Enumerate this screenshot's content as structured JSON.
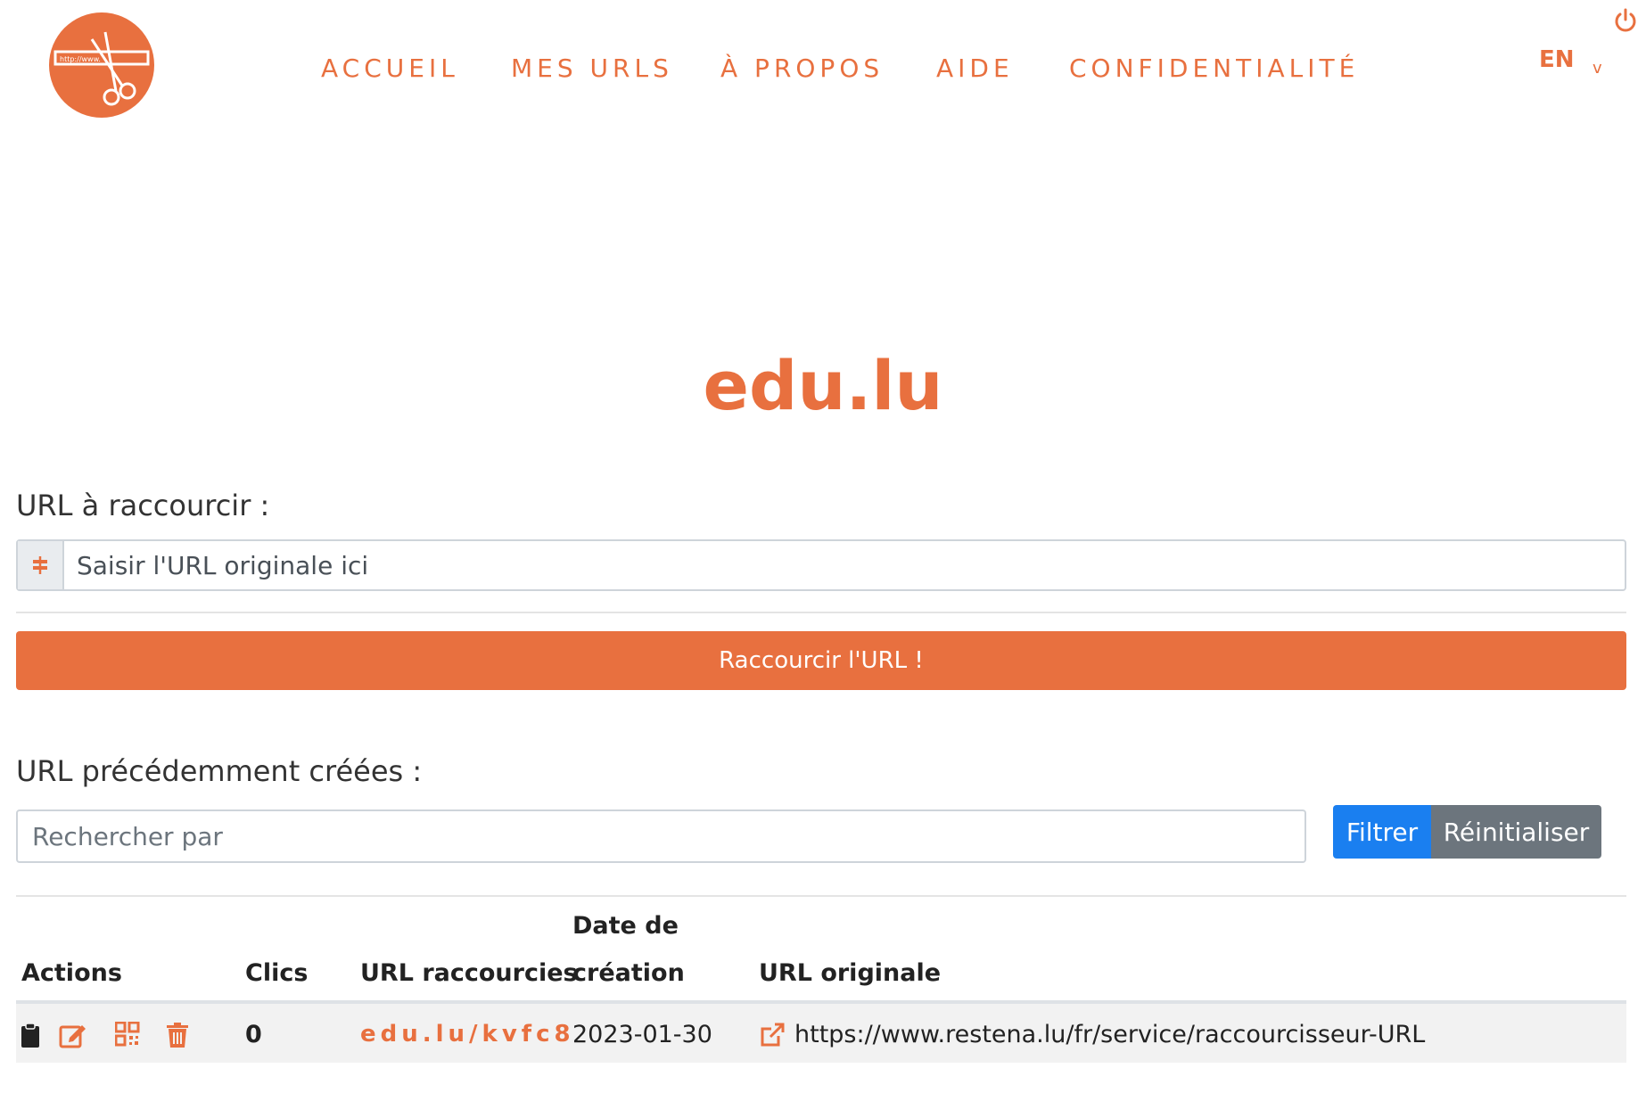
{
  "nav": {
    "items": [
      {
        "label": "ACCUEIL"
      },
      {
        "label": "MES URLS"
      },
      {
        "label": "À PROPOS"
      },
      {
        "label": "AIDE"
      },
      {
        "label": "CONFIDENTIALITÉ"
      }
    ],
    "language": "EN",
    "language_caret": "v"
  },
  "logo": {
    "text": "http://www."
  },
  "site_title": "edu.lu",
  "shorten_form": {
    "label": "URL à raccourcir :",
    "input_placeholder": "Saisir l'URL originale ici",
    "input_value": "",
    "submit_label": "Raccourcir l'URL !"
  },
  "previous": {
    "label": "URL précédemment créées :",
    "search_placeholder": "Rechercher par",
    "filter_label": "Filtrer",
    "reset_label": "Réinitialiser"
  },
  "table": {
    "headers": {
      "actions": "Actions",
      "clicks": "Clics",
      "short_url": "URL raccourcies",
      "created_line1": "Date de",
      "created_line2": "création",
      "original_url": "URL originale"
    },
    "rows": [
      {
        "actions": [
          "clipboard-icon",
          "edit-icon",
          "qr-code-icon",
          "trash-icon"
        ],
        "clicks": "0",
        "short_url": "edu.lu/kvfc8",
        "created": "2023-01-30",
        "original_url": "https://www.restena.lu/fr/service/raccourcisseur-URL"
      }
    ]
  },
  "colors": {
    "accent": "#e8703f",
    "filter_button": "#1a7ff0",
    "reset_button": "#6c757d",
    "row_background": "#f2f2f2"
  }
}
